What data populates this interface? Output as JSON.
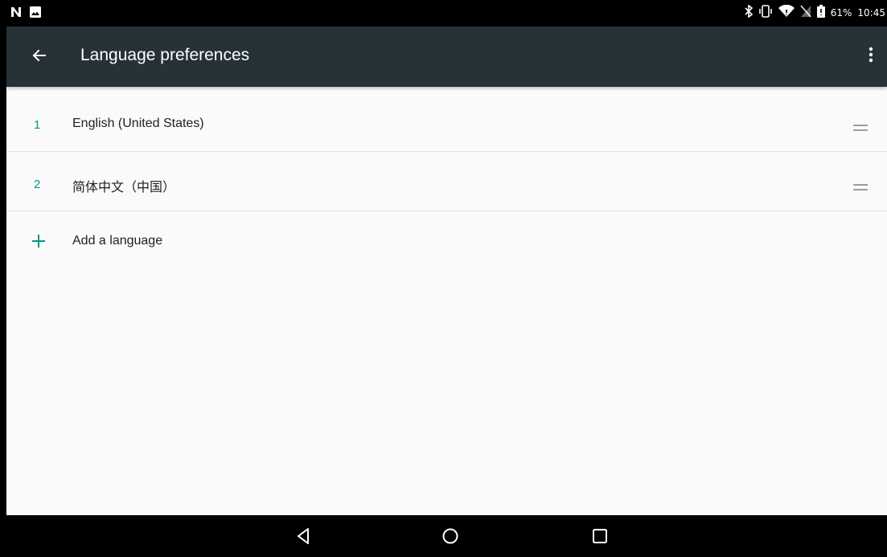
{
  "status_bar": {
    "left_icons": [
      "n-logo-icon",
      "gallery-notification-icon"
    ],
    "right_icons": [
      "bluetooth-icon",
      "vibrate-icon",
      "wifi-icon",
      "no-sim-icon",
      "battery-icon"
    ],
    "battery_percent": "61%",
    "time": "10:45"
  },
  "app_bar": {
    "title": "Language preferences",
    "back_icon": "arrow-back-icon",
    "menu_icon": "more-vert-icon",
    "background": "#263238"
  },
  "languages": [
    {
      "number": "1",
      "name": "English (United States)"
    },
    {
      "number": "2",
      "name": "简体中文（中国）"
    }
  ],
  "add_language": {
    "label": "Add a language",
    "icon": "plus-icon"
  },
  "nav_bar": {
    "buttons": [
      "back-triangle-icon",
      "home-circle-icon",
      "recents-square-icon"
    ]
  },
  "colors": {
    "accent": "#009688",
    "text": "#212121",
    "divider": "#e0e0e0"
  }
}
